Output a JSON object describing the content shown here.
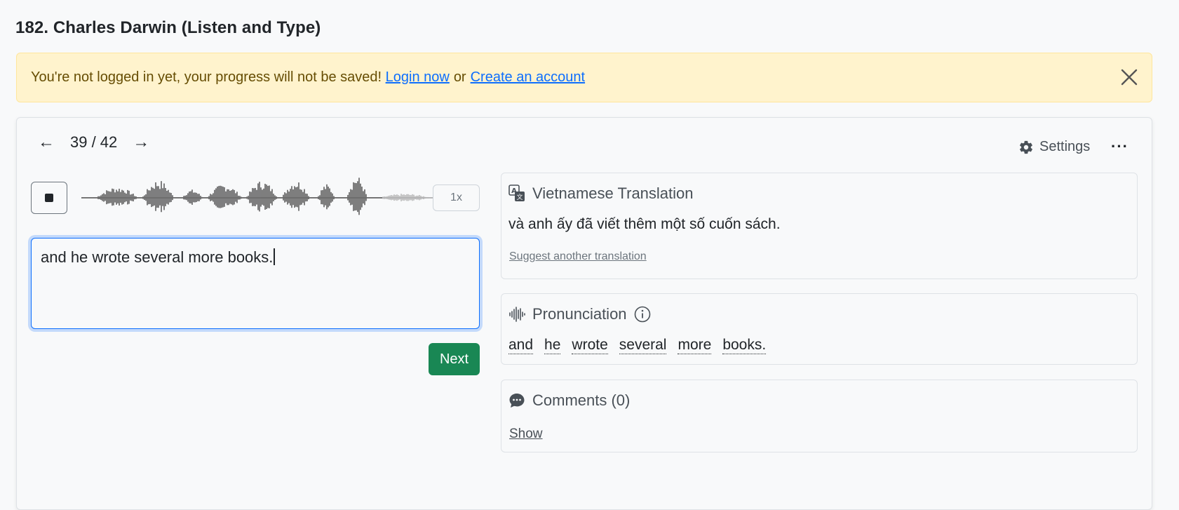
{
  "page": {
    "title": "182. Charles Darwin (Listen and Type)"
  },
  "alert": {
    "message": "You're not logged in yet, your progress will not be saved!",
    "login_link": "Login now",
    "separator": "or",
    "signup_link": "Create an account",
    "close_icon": "close-icon"
  },
  "nav": {
    "prev_icon": "arrow-left-icon",
    "counter": "39 / 42",
    "next_icon": "arrow-right-icon",
    "prev_arrow": "←",
    "next_arrow": "→"
  },
  "toolbar": {
    "settings_label": "Settings",
    "settings_icon": "gear-icon",
    "more_label": "···"
  },
  "player": {
    "stop_icon": "stop-icon",
    "speed": "1x",
    "played_fraction": 0.84
  },
  "answer": {
    "value": "and he wrote several more books."
  },
  "next_button": {
    "label": "Next",
    "color": "#198754"
  },
  "translation_panel": {
    "icon": "translate-icon",
    "title": "Vietnamese Translation",
    "text": "và anh ấy đã viết thêm một số cuốn sách.",
    "suggest_link": "Suggest another translation"
  },
  "pronunciation_panel": {
    "icon": "soundwave-icon",
    "title": "Pronunciation",
    "info_icon": "info-icon",
    "words": [
      "and",
      "he",
      "wrote",
      "several",
      "more",
      "books."
    ]
  },
  "comments_panel": {
    "icon": "chat-bubble-icon",
    "title": "Comments (0)",
    "show_link": "Show"
  },
  "colors": {
    "alert_bg": "#fff3cd",
    "link": "#0d6efd",
    "accent_green": "#198754"
  }
}
